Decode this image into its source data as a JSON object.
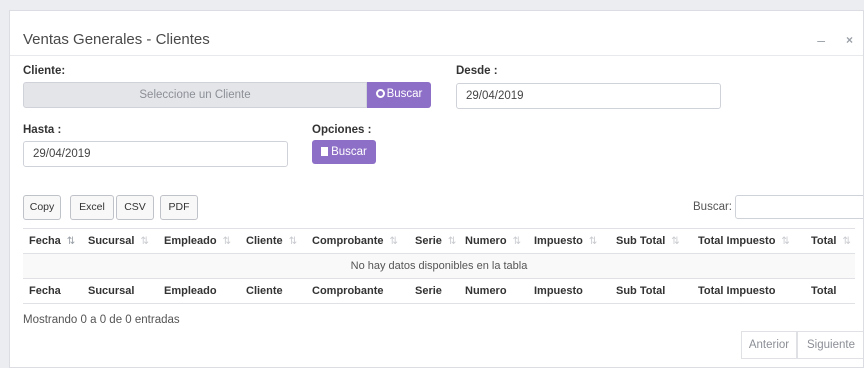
{
  "window": {
    "title": "Ventas Generales - Clientes",
    "minimize_glyph": "–",
    "close_glyph": "×"
  },
  "form": {
    "cliente_label": "Cliente:",
    "cliente_placeholder": "Seleccione un Cliente",
    "buscar_label": "Buscar",
    "desde_label": "Desde :",
    "desde_value": "29/04/2019",
    "hasta_label": "Hasta :",
    "hasta_value": "29/04/2019",
    "opciones_label": "Opciones :",
    "opciones_button": "Buscar"
  },
  "toolbar": {
    "copy": "Copy",
    "excel": "Excel",
    "csv": "CSV",
    "pdf": "PDF",
    "search_label": "Buscar:"
  },
  "table": {
    "columns": [
      "Fecha",
      "Sucursal",
      "Empleado",
      "Cliente",
      "Comprobante",
      "Serie",
      "Numero",
      "Impuesto",
      "Sub Total",
      "Total Impuesto",
      "Total"
    ],
    "empty_message": "No hay datos disponibles en la tabla"
  },
  "footer": {
    "info": "Mostrando 0 a 0 de 0 entradas",
    "prev": "Anterior",
    "next": "Siguiente"
  },
  "colors": {
    "accent": "#8e6fc7",
    "background": "#ecedf1"
  }
}
